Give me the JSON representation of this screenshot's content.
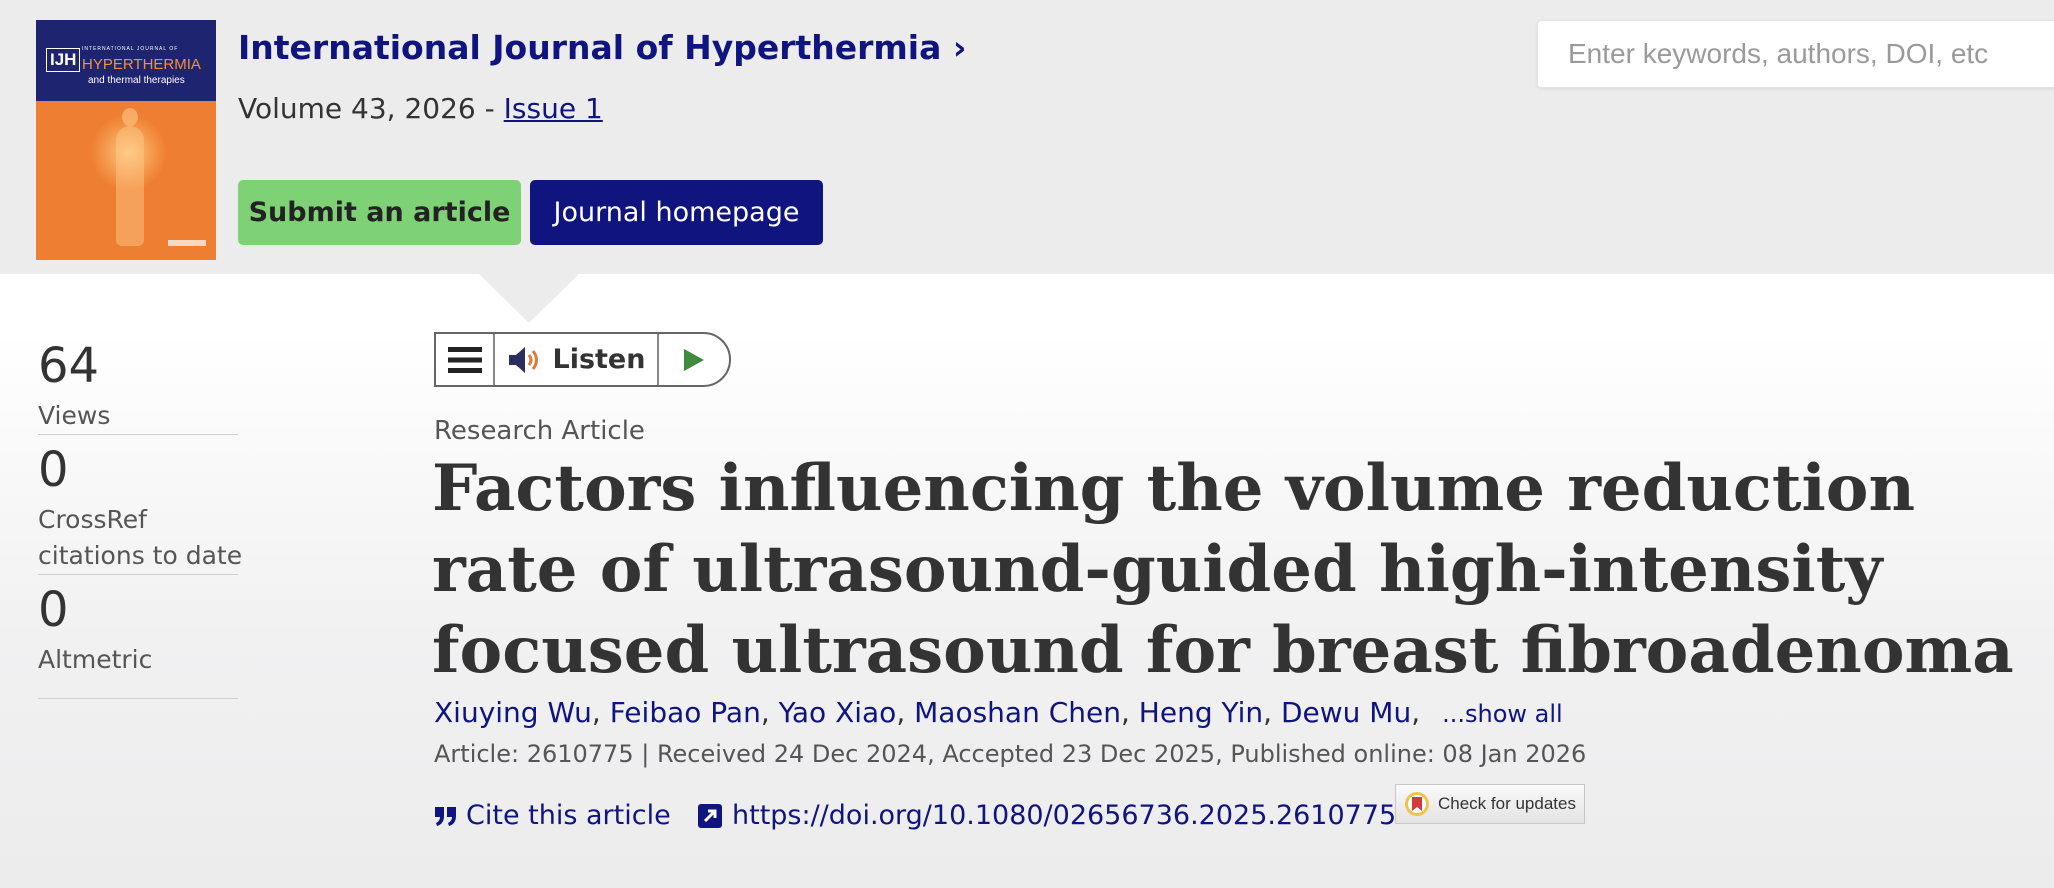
{
  "header": {
    "journal_title": "International Journal of Hyperthermia",
    "journal_chevron": "›",
    "volume_text": "Volume 43, 2026 - ",
    "issue_link": "Issue 1",
    "submit_label": "Submit an article",
    "homepage_label": "Journal homepage",
    "cover": {
      "abbr": "IJH",
      "small_line": "INTERNATIONAL JOURNAL OF",
      "main_title": "HYPERTHERMIA",
      "subtitle": "and thermal therapies"
    }
  },
  "search": {
    "placeholder": "Enter keywords, authors, DOI, etc"
  },
  "metrics": [
    {
      "value": "64",
      "label": "Views"
    },
    {
      "value": "0",
      "label_line1": "CrossRef",
      "label_line2": "citations to date"
    },
    {
      "value": "0",
      "label": "Altmetric"
    }
  ],
  "player": {
    "listen_label": "Listen"
  },
  "article": {
    "type": "Research Article",
    "title": "Factors influencing the volume reduction rate of ultrasound-guided high-intensity focused ultrasound for breast fibroadenoma",
    "authors": [
      "Xiuying Wu",
      "Feibao Pan",
      "Yao Xiao",
      "Maoshan Chen",
      "Heng Yin",
      "Dewu Mu"
    ],
    "show_all": "...show all",
    "meta": "Article: 2610775 | Received 24 Dec 2024, Accepted 23 Dec 2025, Published online: 08 Jan 2026",
    "cite_label": "Cite this article",
    "doi": "https://doi.org/10.1080/02656736.2025.2610775",
    "check_updates": "Check for updates"
  },
  "colors": {
    "brand_navy": "#10147e",
    "submit_green": "#7ed275",
    "cover_orange": "#ee7f32",
    "play_green": "#3e8a3e"
  }
}
